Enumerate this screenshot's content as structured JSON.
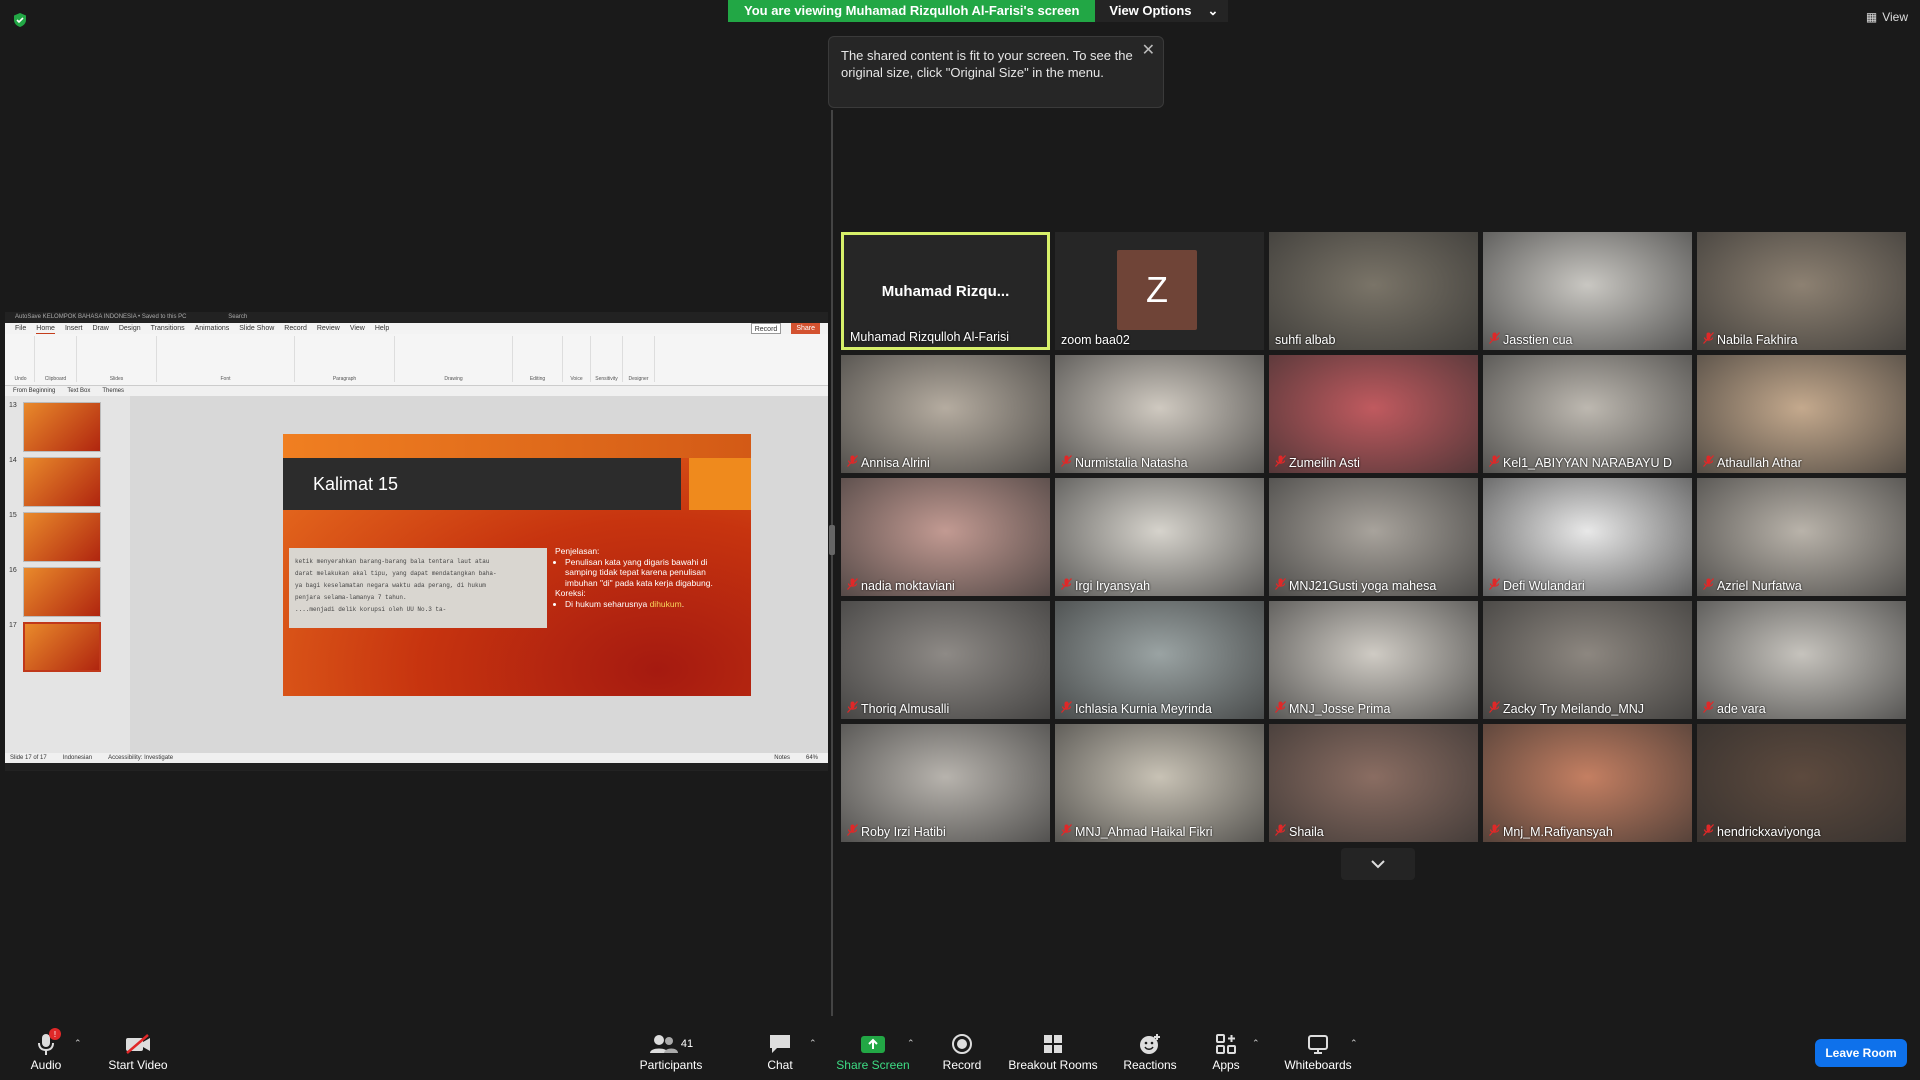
{
  "share_banner": {
    "text": "You are viewing Muhamad Rizqulloh Al-Farisi's screen",
    "view_options": "View Options"
  },
  "top_right": {
    "view": "View"
  },
  "tooltip": {
    "text": "The shared content is fit to your screen. To see the original size, click \"Original Size\" in the menu."
  },
  "ppt": {
    "title": "AutoSave  KELOMPOK BAHASA INDONESIA • Saved to this PC",
    "search": "Search",
    "menu": [
      "File",
      "Home",
      "Insert",
      "Draw",
      "Design",
      "Transitions",
      "Animations",
      "Slide Show",
      "Record",
      "Review",
      "View",
      "Help"
    ],
    "record_btn": "Record",
    "share_btn": "Share",
    "ribbon_groups": [
      "Undo",
      "Clipboard",
      "Slides",
      "Font",
      "Paragraph",
      "Drawing",
      "Editing",
      "Voice",
      "Sensitivity",
      "Designer"
    ],
    "subbar": [
      "From Beginning",
      "Text Box",
      "Themes"
    ],
    "thumb_numbers": [
      "13",
      "14",
      "15",
      "16",
      "17"
    ],
    "slide": {
      "title": "Kalimat 15",
      "scan_lines": [
        "ketik menyerahkan barang-barang  bala tentara  laut atau",
        "darat melakukan akal tipu, yang dapat mendatangkan baha-",
        "ya bagi keselamatan negara waktu ada  perang, di hukum",
        "penjara selama-lamanya 7 tahun.",
        "        ....menjadi delik korupsi oleh UU No.3 ta-"
      ],
      "penjelasan_label": "Penjelasan:",
      "penjelasan_bullet": "Penulisan kata yang digaris bawahi di samping tidak tepat karena penulisan imbuhan \"di\" pada kata kerja digabung.",
      "koreksi_label": "Koreksi:",
      "koreksi_prefix": "Di hukum seharusnya ",
      "koreksi_word": "dihukum",
      "koreksi_suffix": "."
    },
    "status": {
      "slide": "Slide 17 of 17",
      "lang": "Indonesian",
      "accessibility": "Accessibility: Investigate",
      "notes": "Notes",
      "zoom": "64%"
    }
  },
  "participants": [
    {
      "name": "Muhamad Rizqulloh Al-Farisi",
      "bigname": "Muhamad  Rizqu...",
      "muted": false,
      "active": true,
      "type": "name"
    },
    {
      "name": "zoom baa02",
      "initial": "Z",
      "muted": false,
      "type": "avatar"
    },
    {
      "name": "suhfi albab",
      "muted": false,
      "color": "#7a7468"
    },
    {
      "name": "Jasstien cua",
      "muted": true,
      "color": "#c9c7c2"
    },
    {
      "name": "Nabila Fakhira",
      "muted": true,
      "color": "#8d8172"
    },
    {
      "name": "Annisa Alrini",
      "muted": true,
      "color": "#b5aca0"
    },
    {
      "name": "Nurmistalia Natasha",
      "muted": true,
      "color": "#cfc9c0"
    },
    {
      "name": "Zumeilin Asti",
      "muted": true,
      "color": "#c05a5f"
    },
    {
      "name": "Kel1_ABIYYAN NARABAYU D",
      "muted": true,
      "color": "#bdb8b0"
    },
    {
      "name": "Athaullah Athar",
      "muted": true,
      "color": "#c4a98d"
    },
    {
      "name": "nadia moktaviani",
      "muted": true,
      "color": "#c29a92"
    },
    {
      "name": "Irgi Iryansyah",
      "muted": true,
      "color": "#d6d3cc"
    },
    {
      "name": "MNJ21Gusti yoga mahesa",
      "muted": true,
      "color": "#a8a39c"
    },
    {
      "name": "Defi Wulandari",
      "muted": true,
      "color": "#e8e8e8"
    },
    {
      "name": "Azriel Nurfatwa",
      "muted": true,
      "color": "#b9b3aa"
    },
    {
      "name": "Thoriq Almusalli",
      "muted": true,
      "color": "#8e8a86"
    },
    {
      "name": "Ichlasia Kurnia Meyrinda",
      "muted": true,
      "color": "#9aa3a3"
    },
    {
      "name": "MNJ_Josse Prima",
      "muted": true,
      "color": "#cfcbc4"
    },
    {
      "name": "Zacky Try Meilando_MNJ",
      "muted": true,
      "color": "#8d8780"
    },
    {
      "name": "ade vara",
      "muted": true,
      "color": "#c6c3bd"
    },
    {
      "name": "Roby Irzi Hatibi",
      "muted": true,
      "color": "#b7b3ad"
    },
    {
      "name": "MNJ_Ahmad Haikal Fikri",
      "muted": true,
      "color": "#c8c2b5"
    },
    {
      "name": "Shaila",
      "muted": true,
      "color": "#8a6d62"
    },
    {
      "name": "Mnj_M.Rafiyansyah",
      "muted": true,
      "color": "#c47f62"
    },
    {
      "name": "hendrickxaviyonga",
      "muted": true,
      "color": "#5d4a3e"
    }
  ],
  "toolbar": {
    "audio": "Audio",
    "audio_badge": "!",
    "start_video": "Start Video",
    "participants": "Participants",
    "participants_count": "41",
    "chat": "Chat",
    "share_screen": "Share Screen",
    "record": "Record",
    "breakout": "Breakout Rooms",
    "reactions": "Reactions",
    "apps": "Apps",
    "whiteboards": "Whiteboards",
    "leave": "Leave Room"
  },
  "colors": {
    "share_green": "#22a745",
    "active_speaker": "#d7f06a",
    "leave_blue": "#0e71eb",
    "muted_red": "#e02828"
  }
}
